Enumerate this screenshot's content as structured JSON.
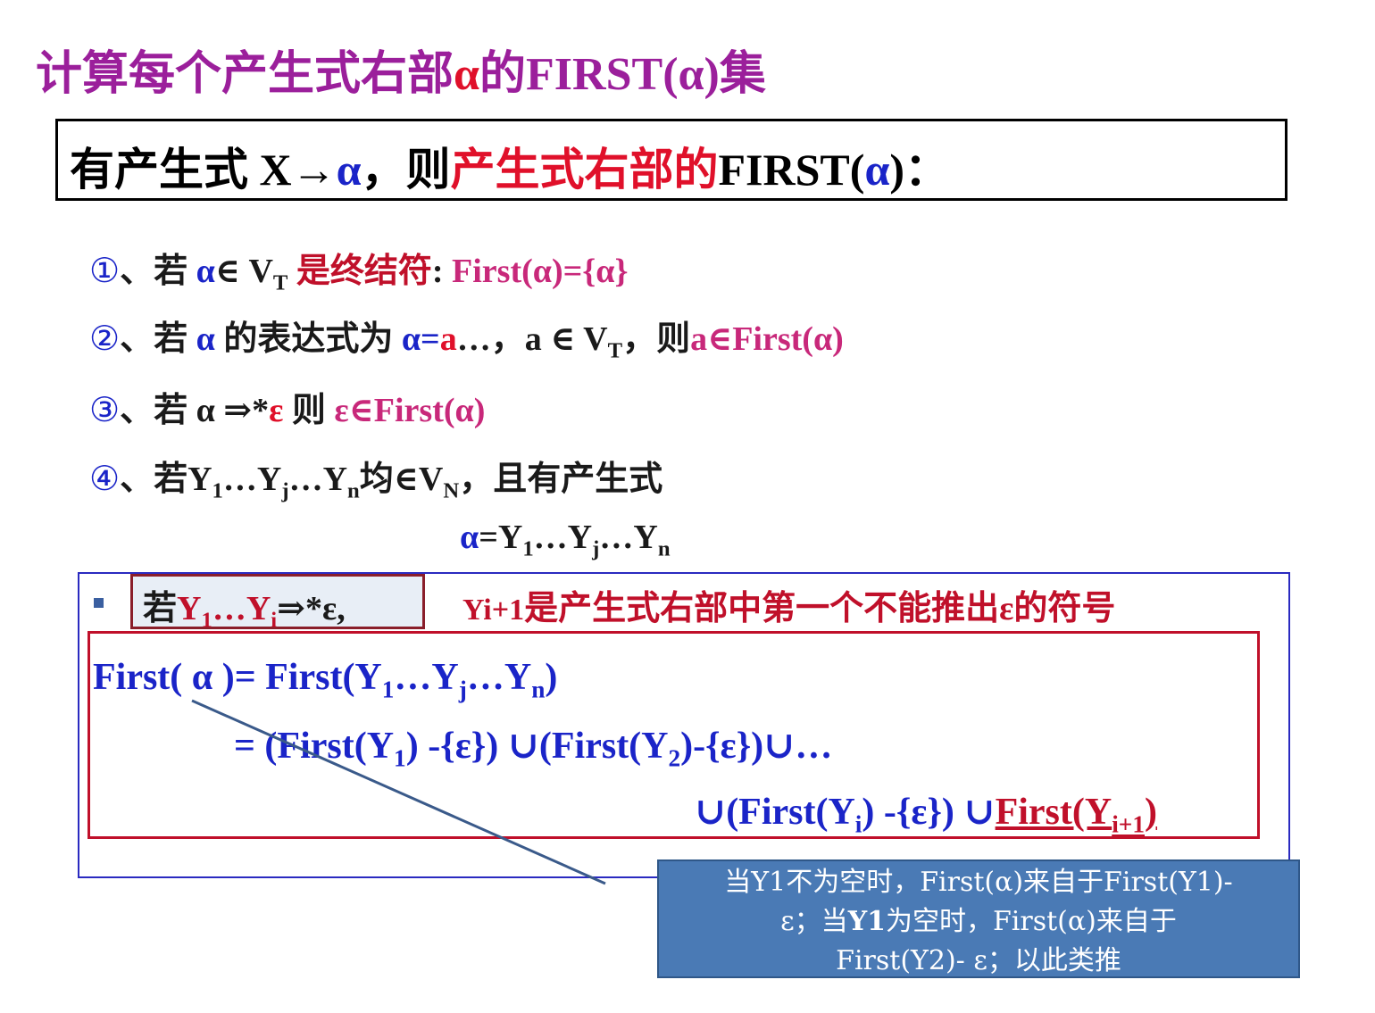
{
  "title": {
    "part1": "计算每个产生式右部",
    "alpha": "α",
    "part2": "的FIRST(α)集"
  },
  "definition": {
    "part1": "有产生式 X→",
    "alpha": "α",
    "part2": "，则",
    "red": "产生式右部的",
    "part3": "FIRST(",
    "alpha2": "α",
    "part4": ")："
  },
  "rules": [
    {
      "num": "①",
      "sep": "、若  ",
      "a": "α",
      "in": "∈ V",
      "sub": "T",
      "red": " 是终结符",
      "colon": ": ",
      "pink": "First(α)={α}"
    },
    {
      "num": "②",
      "sep": "、若  ",
      "a": "α",
      "text": " 的表达式为 ",
      "eq1": "α=",
      "redA": "a",
      "eq2": "…，a ∈ V",
      "sub": "T",
      "then": "，则",
      "pink": "a∈First(α)"
    },
    {
      "num": "③",
      "sep": "、若 α ⇒*",
      "eps": "ε",
      "then": "  则 ",
      "pink": "ε∈First(α)"
    },
    {
      "num": "④",
      "sep": "、若",
      "y1": "Y",
      "s1": "1",
      "dots1": "…Y",
      "sj": "j",
      "dots2": "…Y",
      "sn": "n",
      "rest": "均∈V",
      "sN": "N",
      "tail": "，且有产生式"
    }
  ],
  "production": {
    "a": "α",
    "eq": "=Y",
    "s1": "1",
    "d1": "…Y",
    "sj": "j",
    "d2": "…Y",
    "sn": "n"
  },
  "condition": {
    "prefix": "若",
    "y1": "Y",
    "s1": "1",
    "dots": "…Y",
    "si": "i",
    "arrow": "⇒*ε,"
  },
  "note": {
    "y": "Yi+1",
    "text": "是产生式右部中第一个不能推出ε的符号"
  },
  "formula": {
    "line1": {
      "a": "First( α )= First(Y",
      "s1": "1",
      "b": "…Y",
      "sj": "j",
      "c": "…Y",
      "sn": "n",
      "d": ")"
    },
    "line2": {
      "a": "= (First(Y",
      "s1": "1",
      "b": ") -{ε}) ∪(First(Y",
      "s2": "2",
      "c": ")-{ε})∪…"
    },
    "line3": {
      "a": "∪(First(Y",
      "si": "i",
      "b": ") -{ε}) ∪",
      "u1": "First(Y",
      "si1": "i+1",
      "u2": ")"
    }
  },
  "callout": {
    "line1": "当Y1不为空时，First(α)来自于First(Y1)-",
    "line2a": "ε；当",
    "line2b": "Y1",
    "line2c": "为空时，First(α)来自于",
    "line3": "First(Y2)- ε；以此类推"
  },
  "colors": {
    "title": "#9b1f9b",
    "blue": "#1a24c8",
    "red": "#e0102a",
    "pink": "#c8287a",
    "callout": "#4a7ab5"
  }
}
